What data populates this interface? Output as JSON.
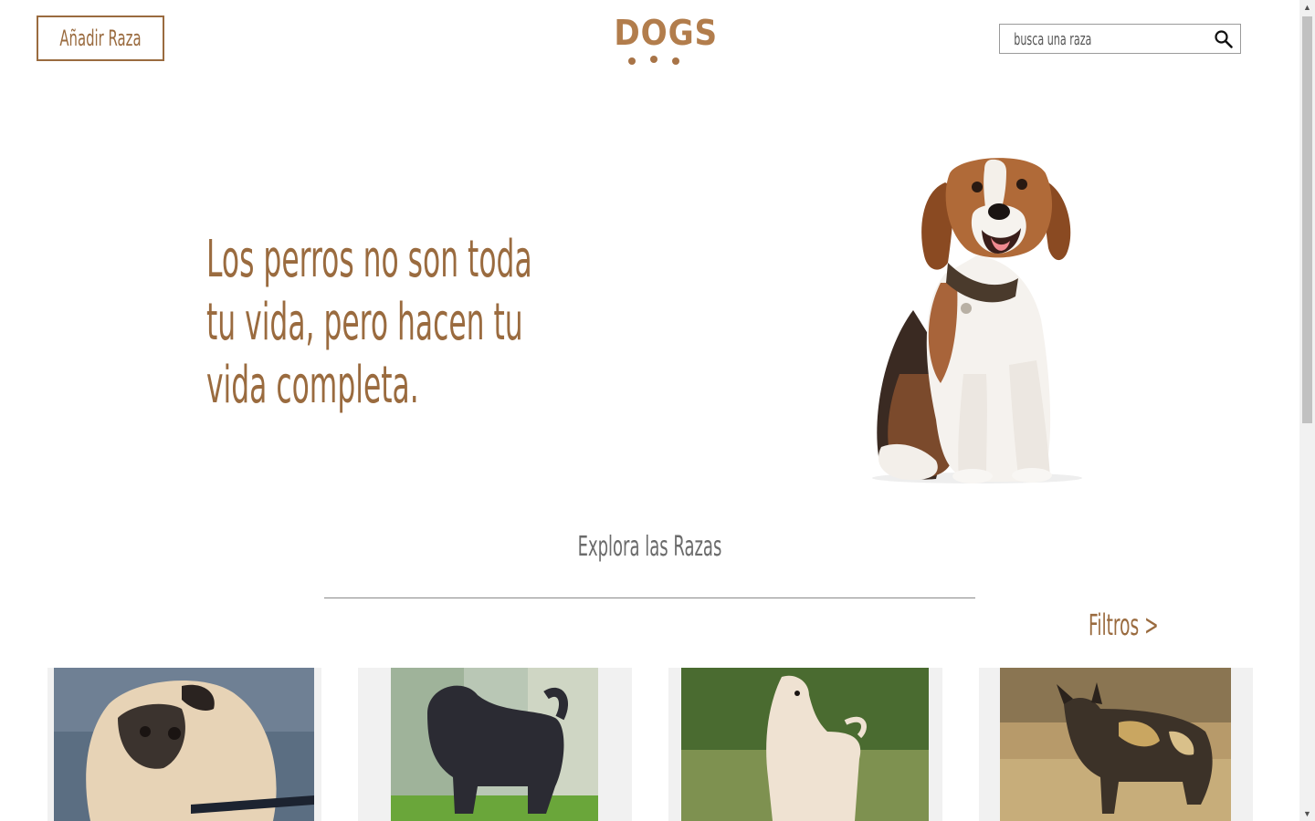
{
  "header": {
    "add_breed_label": "Añadir Raza",
    "logo_text": "DOGS",
    "search": {
      "placeholder": "busca una raza",
      "value": ""
    }
  },
  "hero": {
    "quote_lines": [
      "Los perros no son toda",
      "tu vida, pero hacen tu",
      "vida completa."
    ]
  },
  "explore": {
    "title": "Explora las Razas",
    "filters_label": "Filtros >"
  },
  "colors": {
    "brand": "#9a6b3f",
    "logo": "#b27d4c",
    "card_bg": "#f1f1f1"
  },
  "icons": [
    "search-icon",
    "paw-dots-icon"
  ],
  "breed_cards": [
    {
      "image": "pug-photo"
    },
    {
      "image": "affenpinscher-photo"
    },
    {
      "image": "afghan-hound-photo"
    },
    {
      "image": "african-wild-dog-photo"
    }
  ]
}
